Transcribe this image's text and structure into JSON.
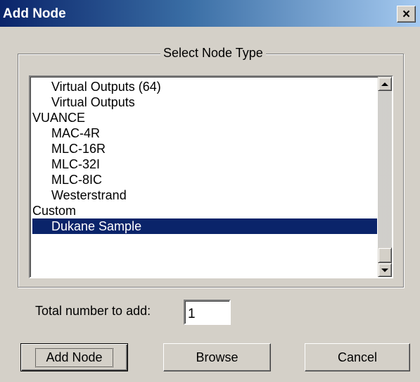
{
  "window": {
    "title": "Add Node",
    "close_glyph": "×"
  },
  "group": {
    "legend": "Select Node Type"
  },
  "list": {
    "items": [
      {
        "label": "Virtual Outputs (64)",
        "indent": true,
        "selected": false
      },
      {
        "label": "Virtual Outputs",
        "indent": true,
        "selected": false
      },
      {
        "label": "VUANCE",
        "indent": false,
        "selected": false
      },
      {
        "label": "MAC-4R",
        "indent": true,
        "selected": false
      },
      {
        "label": "MLC-16R",
        "indent": true,
        "selected": false
      },
      {
        "label": "MLC-32I",
        "indent": true,
        "selected": false
      },
      {
        "label": "MLC-8IC",
        "indent": true,
        "selected": false
      },
      {
        "label": "Westerstrand",
        "indent": true,
        "selected": false
      },
      {
        "label": "Custom",
        "indent": false,
        "selected": false
      },
      {
        "label": "Dukane Sample",
        "indent": true,
        "selected": true
      }
    ]
  },
  "total": {
    "label": "Total number to add:",
    "value": "1"
  },
  "buttons": {
    "add_node": "Add Node",
    "browse": "Browse",
    "cancel": "Cancel"
  },
  "colors": {
    "titlebar_start": "#0a246a",
    "selection": "#0a246a",
    "face": "#d4d0c8"
  }
}
